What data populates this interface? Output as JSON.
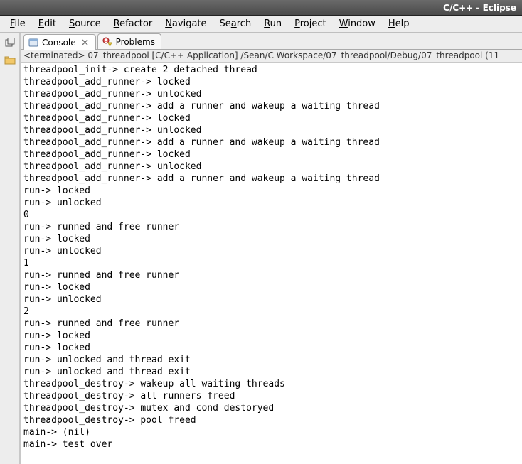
{
  "window": {
    "title": "C/C++ - Eclipse"
  },
  "menubar": {
    "items": [
      {
        "label": "File",
        "mn": 0
      },
      {
        "label": "Edit",
        "mn": 0
      },
      {
        "label": "Source",
        "mn": 0
      },
      {
        "label": "Refactor",
        "mn": 0
      },
      {
        "label": "Navigate",
        "mn": 0
      },
      {
        "label": "Search",
        "mn": 2
      },
      {
        "label": "Run",
        "mn": 0
      },
      {
        "label": "Project",
        "mn": 0
      },
      {
        "label": "Window",
        "mn": 0
      },
      {
        "label": "Help",
        "mn": 0
      }
    ]
  },
  "tabs": {
    "console": "Console",
    "problems": "Problems"
  },
  "console": {
    "header": "<terminated> 07_threadpool [C/C++ Application] /Sean/C Workspace/07_threadpool/Debug/07_threadpool (11",
    "lines": [
      "threadpool_init-> create 2 detached thread",
      "threadpool_add_runner-> locked",
      "threadpool_add_runner-> unlocked",
      "threadpool_add_runner-> add a runner and wakeup a waiting thread",
      "threadpool_add_runner-> locked",
      "threadpool_add_runner-> unlocked",
      "threadpool_add_runner-> add a runner and wakeup a waiting thread",
      "threadpool_add_runner-> locked",
      "threadpool_add_runner-> unlocked",
      "threadpool_add_runner-> add a runner and wakeup a waiting thread",
      "run-> locked",
      "run-> unlocked",
      "0",
      "run-> runned and free runner",
      "run-> locked",
      "run-> unlocked",
      "1",
      "run-> runned and free runner",
      "run-> locked",
      "run-> unlocked",
      "2",
      "run-> runned and free runner",
      "run-> locked",
      "run-> locked",
      "run-> unlocked and thread exit",
      "run-> unlocked and thread exit",
      "threadpool_destroy-> wakeup all waiting threads",
      "threadpool_destroy-> all runners freed",
      "threadpool_destroy-> mutex and cond destoryed",
      "threadpool_destroy-> pool freed",
      "main-> (nil)",
      "main-> test over"
    ]
  }
}
